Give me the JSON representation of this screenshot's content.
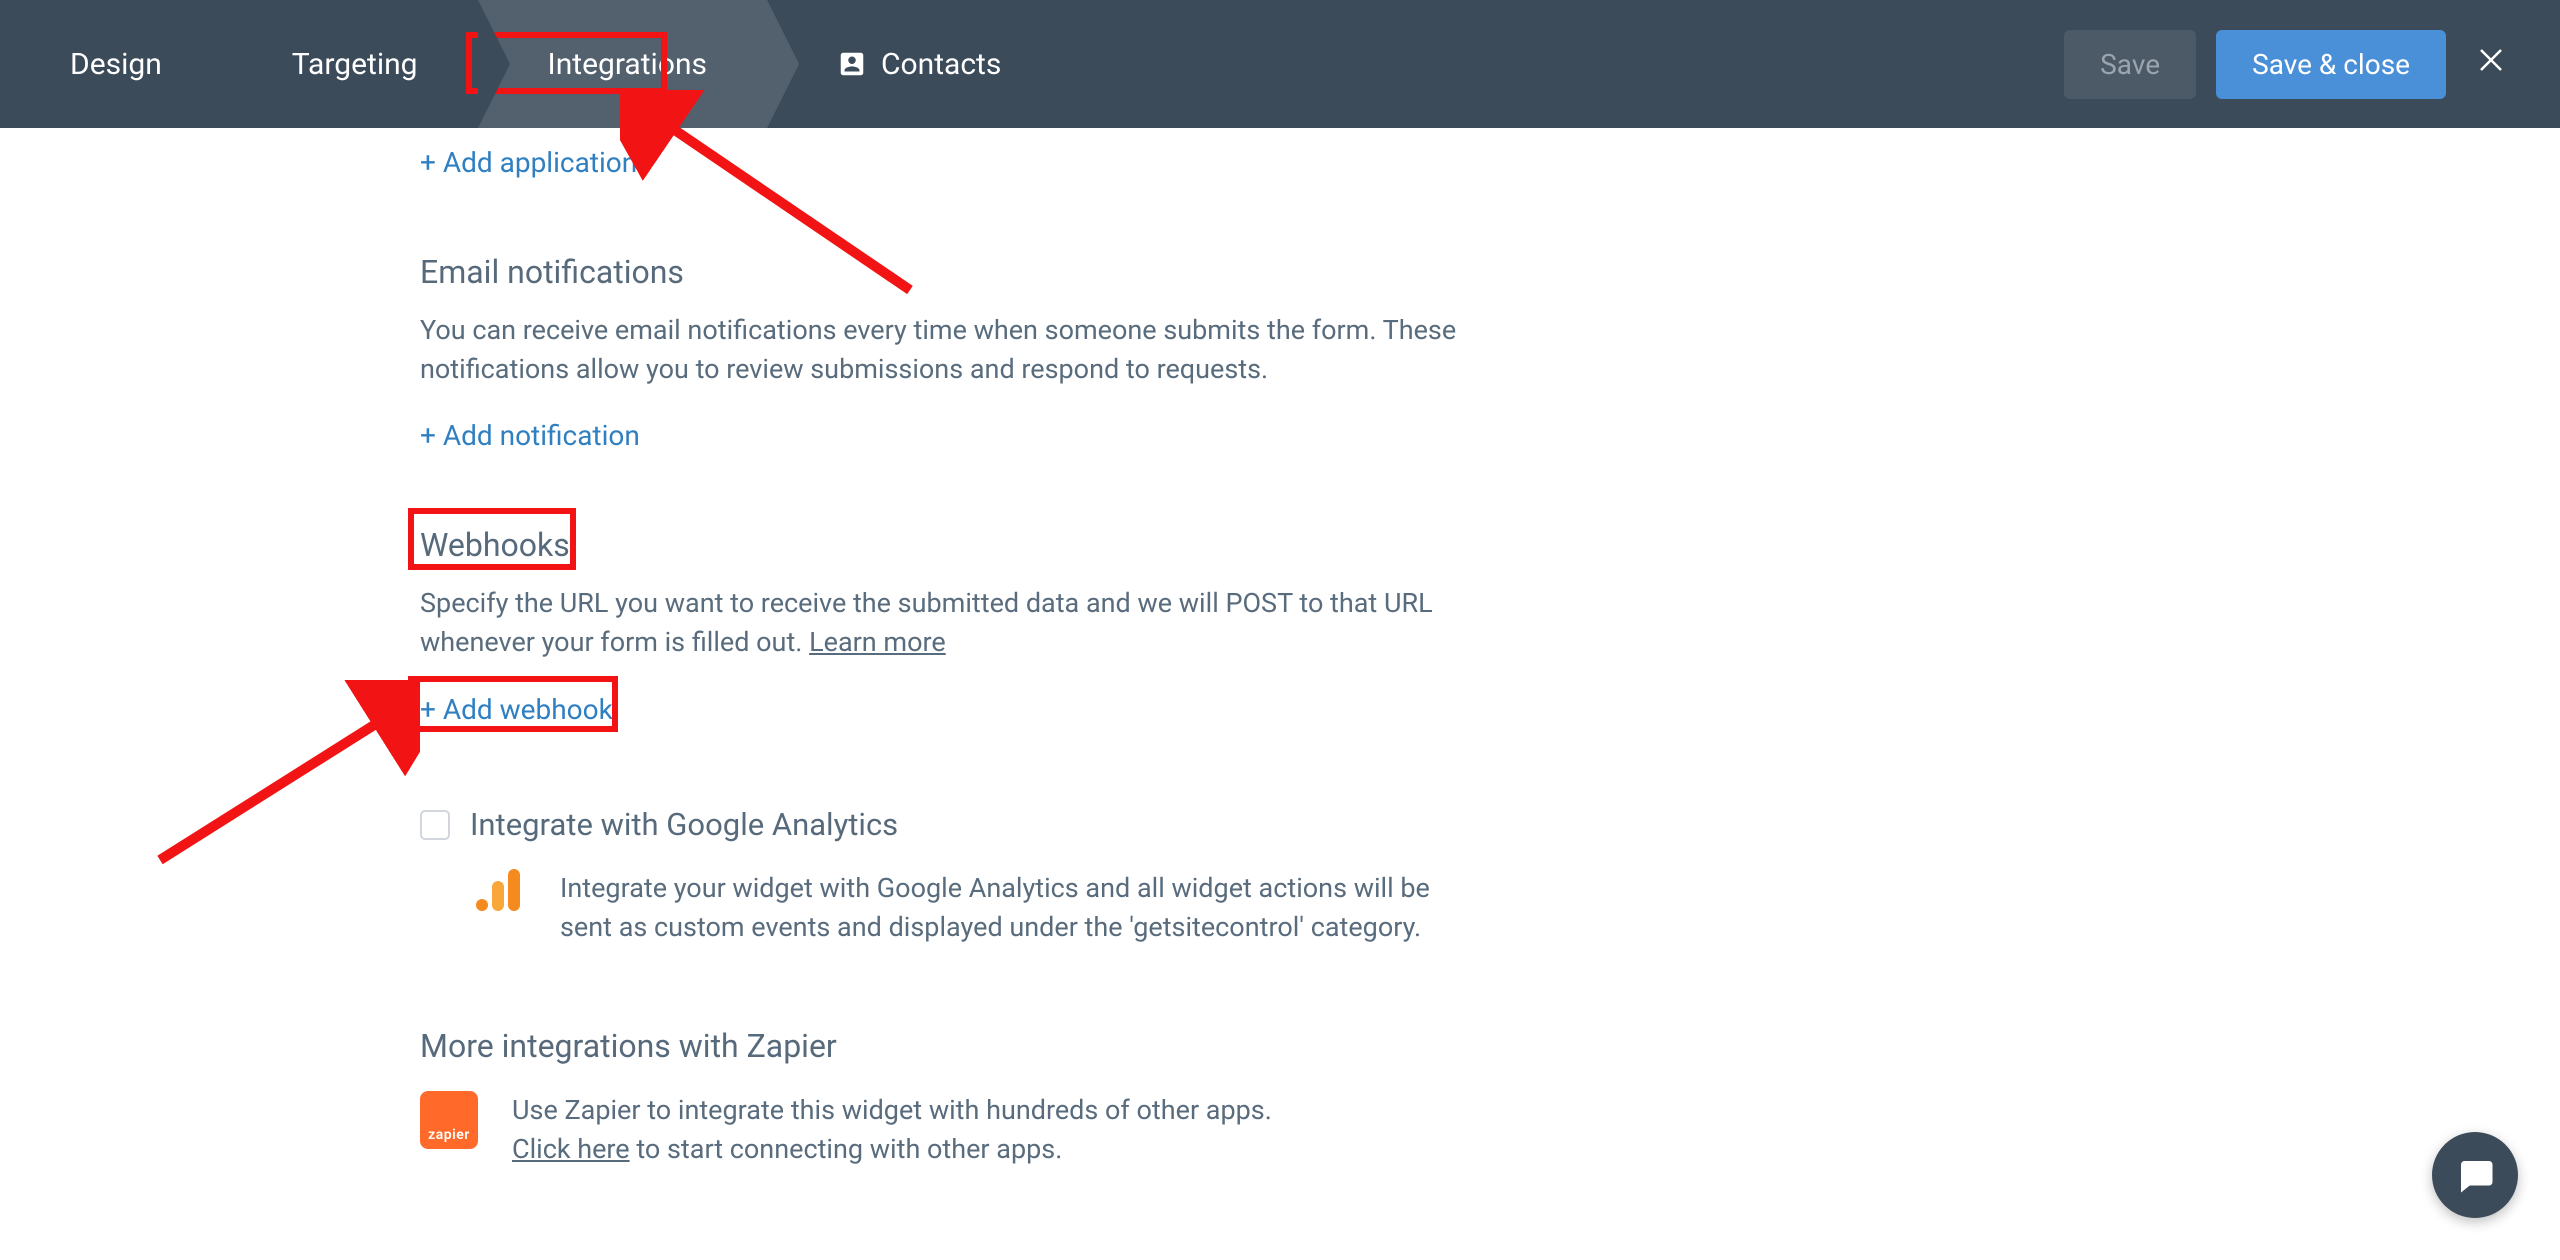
{
  "nav": {
    "tabs": {
      "design": "Design",
      "targeting": "Targeting",
      "integrations": "Integrations",
      "contacts": "Contacts"
    },
    "save": "Save",
    "save_close": "Save & close"
  },
  "actions": {
    "add_application": "+ Add application",
    "add_notification": "+ Add notification",
    "add_webhook": "+ Add webhook"
  },
  "email": {
    "title": "Email notifications",
    "desc": "You can receive email notifications every time when someone submits the form. These notifications allow you to review submissions and respond to requests."
  },
  "webhooks": {
    "title": "Webhooks",
    "desc_pre": "Specify the URL you want to receive the submitted data and we will POST to that URL whenever your form is filled out. ",
    "learn_more": "Learn more"
  },
  "ga": {
    "label": "Integrate with Google Analytics",
    "desc": "Integrate your widget with Google Analytics and all widget actions will be sent as custom events and displayed under the 'getsitecontrol' category."
  },
  "zapier": {
    "title": "More integrations with Zapier",
    "badge": "zapier",
    "pre": "Use Zapier to integrate this widget with hundreds of other apps. ",
    "click_here": "Click here",
    "post": " to start connecting with other apps."
  }
}
